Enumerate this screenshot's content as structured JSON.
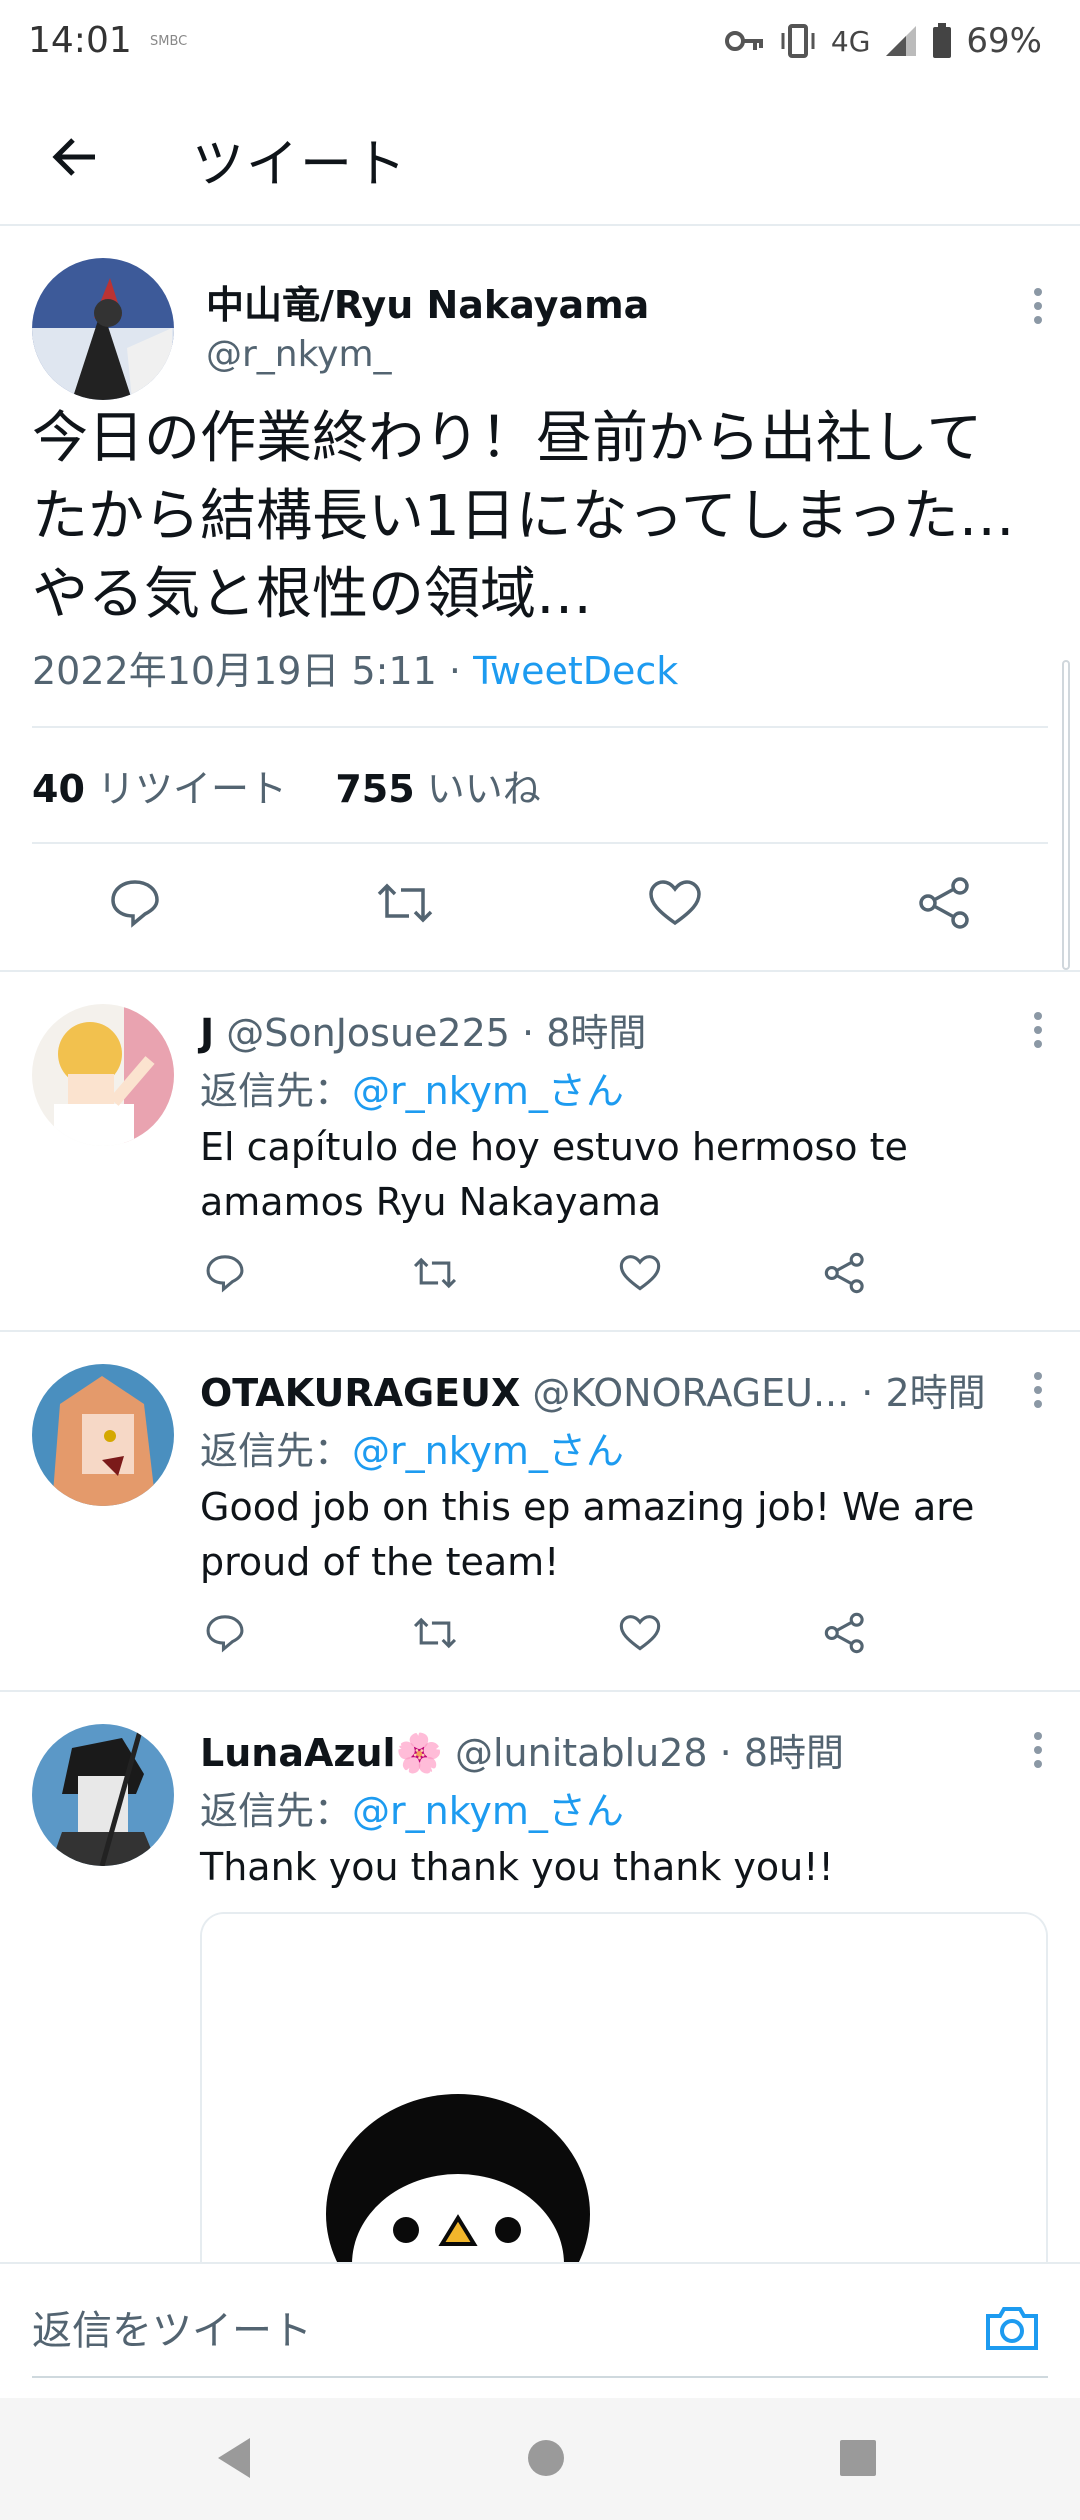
{
  "status": {
    "time": "14:01",
    "carrier": "SMBC",
    "network": "4G",
    "battery": "69%"
  },
  "header": {
    "title": "ツイート"
  },
  "tweet": {
    "author_name": "中山竜/Ryu Nakayama",
    "author_handle": "@r_nkym_",
    "text": "今日の作業終わり！昼前から出社してたから結構長い1日になってしまった…やる気と根性の領域…",
    "date": "2022年10月19日 5:11",
    "separator": "·",
    "source": "TweetDeck",
    "retweets_count": "40",
    "retweets_label": "リツイート",
    "likes_count": "755",
    "likes_label": "いいね"
  },
  "replies": [
    {
      "name": "J",
      "handle": "@SonJosue225",
      "time": "· 8時間",
      "reply_to_label": "返信先：",
      "reply_to": "@r_nkym_さん",
      "text": "El capítulo de hoy estuvo hermoso te amamos Ryu Nakayama"
    },
    {
      "name": "OTAKURAGEUX",
      "handle": "@KONORAGEU...",
      "time": "· 2時間",
      "reply_to_label": "返信先：",
      "reply_to": "@r_nkym_さん",
      "text": "Good job on this ep amazing job! We are proud of the team!"
    },
    {
      "name": "LunaAzul🌸",
      "handle": "@lunitablu28",
      "time": "· 8時間",
      "reply_to_label": "返信先：",
      "reply_to": "@r_nkym_さん",
      "text": "Thank you thank you thank you!!"
    }
  ],
  "compose": {
    "placeholder": "返信をツイート"
  },
  "colors": {
    "accent": "#1d9bf0",
    "text": "#0f1419",
    "secondary": "#536471",
    "divider": "#e6ecf0"
  }
}
